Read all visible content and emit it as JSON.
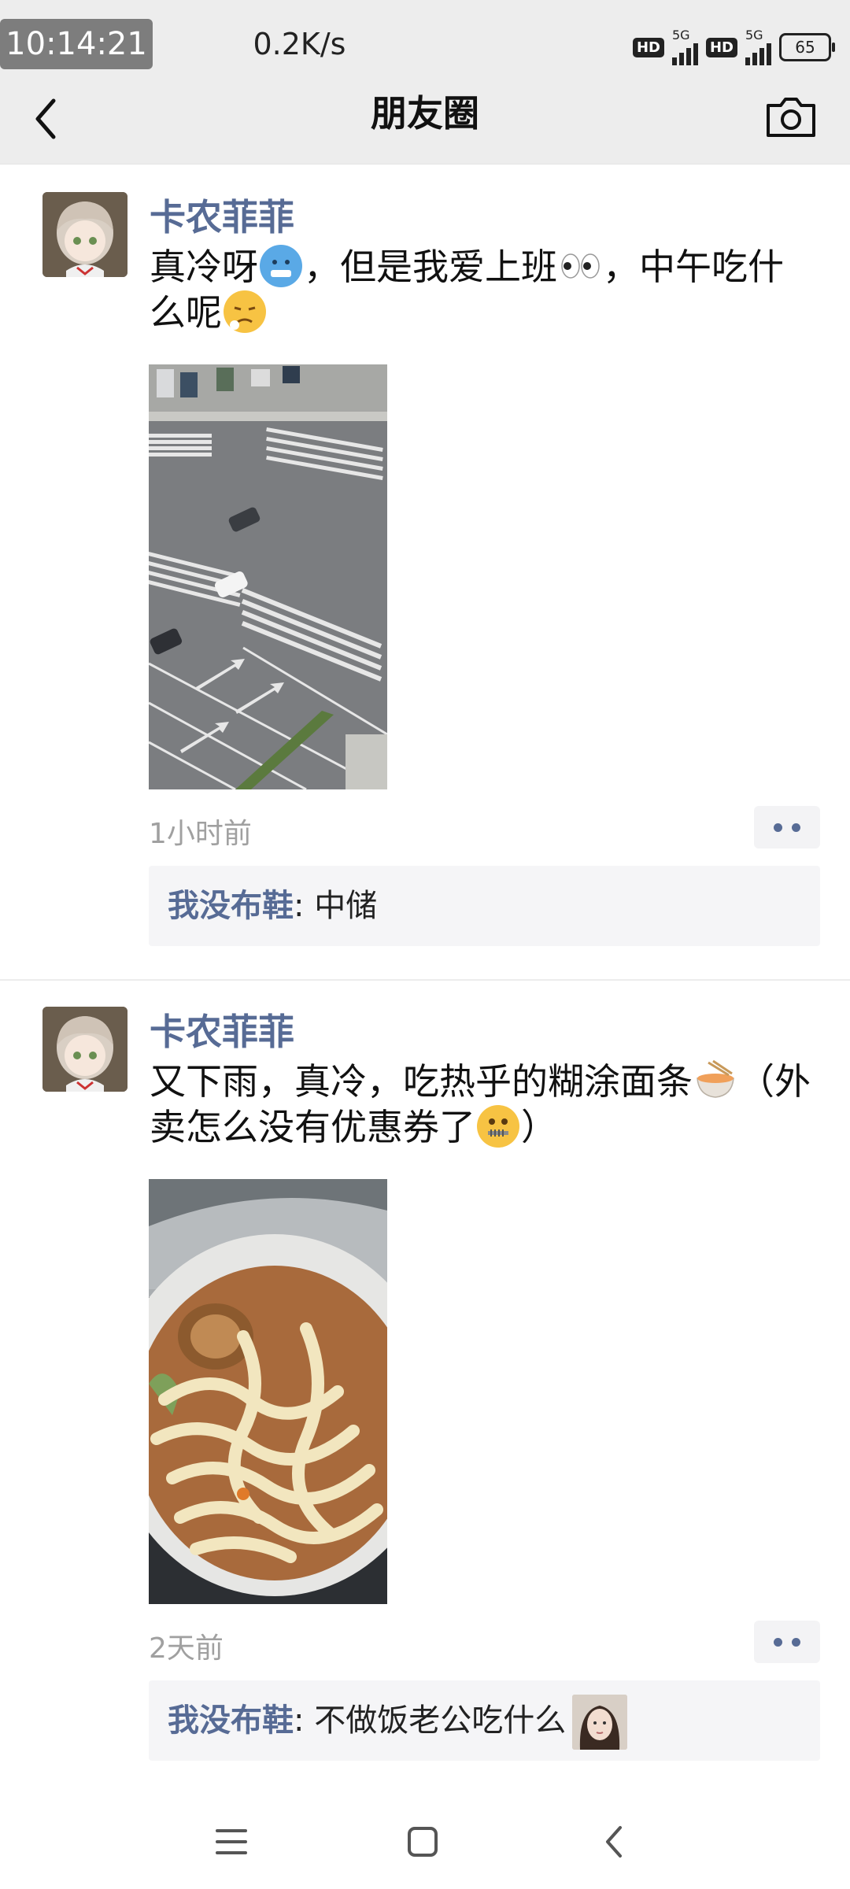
{
  "status_bar": {
    "time": "10:14:21",
    "net_speed": "0.2K/s",
    "hd_label": "HD",
    "network_1": "5G",
    "network_2": "5G",
    "battery": "65",
    "icons": [
      "hd-icon",
      "signal-icon",
      "hd-icon",
      "signal-icon",
      "battery-icon"
    ]
  },
  "header": {
    "title": "朋友圈",
    "back_icon": "chevron-left-icon",
    "camera_icon": "camera-icon"
  },
  "posts": [
    {
      "user": "卡农菲菲",
      "text_1": "真冷呀",
      "text_2": "，但是我爱上班",
      "text_3": "，中午吃什么呢",
      "photo": "street-intersection-photo",
      "time": "1小时前",
      "comment": {
        "author": "我没布鞋",
        "separator": ": ",
        "text": "中储"
      }
    },
    {
      "user": "卡农菲菲",
      "text_1": "又下雨，真冷，吃热乎的糊涂面条",
      "text_2": "（外卖怎么没有优惠券了",
      "text_3": "）",
      "photo": "noodle-soup-photo",
      "time": "2天前",
      "comment": {
        "author": "我没布鞋",
        "separator": ": ",
        "text": "不做饭老公吃什么"
      }
    }
  ],
  "colors": {
    "link_blue": "#576b95",
    "bar_bg": "#ededed",
    "comment_bg": "#f5f5f7"
  },
  "nav": {
    "icons": [
      "menu-icon",
      "home-icon",
      "back-icon"
    ]
  }
}
